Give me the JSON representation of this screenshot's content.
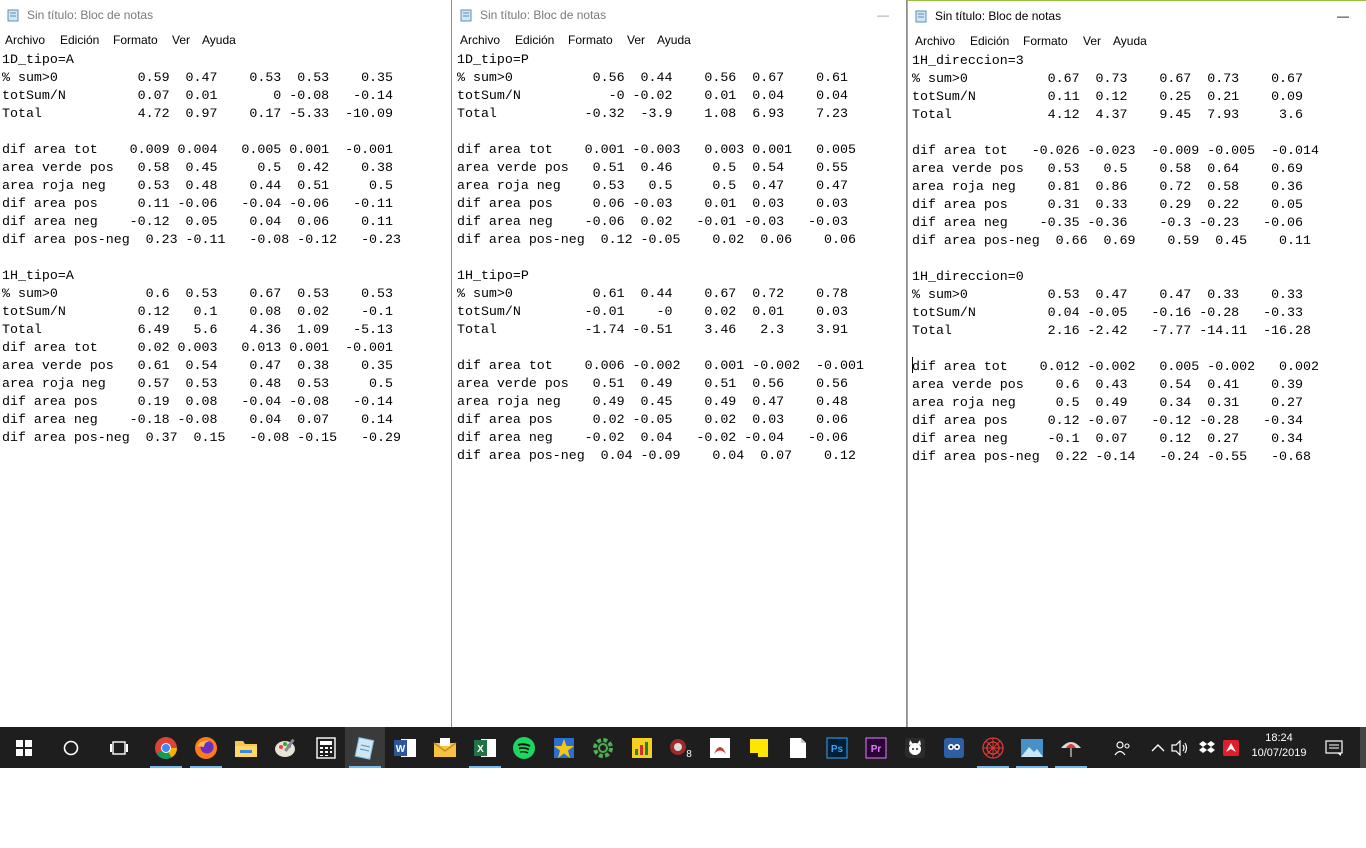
{
  "windows": [
    {
      "title": "Sin título: Bloc de notas",
      "menu": [
        "Archivo",
        "Edición",
        "Formato",
        "Ver",
        "Ayuda"
      ],
      "content": "1D_tipo=A\n% sum>0          0.59  0.47    0.53  0.53    0.35\ntotSum/N         0.07  0.01       0 -0.08   -0.14\nTotal            4.72  0.97    0.17 -5.33  -10.09\n\ndif area tot    0.009 0.004   0.005 0.001  -0.001\narea verde pos   0.58  0.45     0.5  0.42    0.38\narea roja neg    0.53  0.48    0.44  0.51     0.5\ndif area pos     0.11 -0.06   -0.04 -0.06   -0.11\ndif area neg    -0.12  0.05    0.04  0.06    0.11\ndif area pos-neg  0.23 -0.11   -0.08 -0.12   -0.23\n\n1H_tipo=A\n% sum>0           0.6  0.53    0.67  0.53    0.53\ntotSum/N         0.12   0.1    0.08  0.02    -0.1\nTotal            6.49   5.6    4.36  1.09   -5.13\ndif area tot     0.02 0.003   0.013 0.001  -0.001\narea verde pos   0.61  0.54    0.47  0.38    0.35\narea roja neg    0.57  0.53    0.48  0.53     0.5\ndif area pos     0.19  0.08   -0.04 -0.08   -0.14\ndif area neg    -0.18 -0.08    0.04  0.07    0.14\ndif area pos-neg  0.37  0.15   -0.08 -0.15   -0.29"
    },
    {
      "title": "Sin título: Bloc de notas",
      "minimize": "—",
      "menu": [
        "Archivo",
        "Edición",
        "Formato",
        "Ver",
        "Ayuda"
      ],
      "content": "1D_tipo=P\n% sum>0          0.56  0.44    0.56  0.67    0.61\ntotSum/N           -0 -0.02    0.01  0.04    0.04\nTotal           -0.32  -3.9    1.08  6.93    7.23\n\ndif area tot    0.001 -0.003   0.003 0.001   0.005\narea verde pos   0.51  0.46     0.5  0.54    0.55\narea roja neg    0.53   0.5     0.5  0.47    0.47\ndif area pos     0.06 -0.03    0.01  0.03    0.03\ndif area neg    -0.06  0.02   -0.01 -0.03   -0.03\ndif area pos-neg  0.12 -0.05    0.02  0.06    0.06\n\n1H_tipo=P\n% sum>0          0.61  0.44    0.67  0.72    0.78\ntotSum/N        -0.01    -0    0.02  0.01    0.03\nTotal           -1.74 -0.51    3.46   2.3    3.91\n\ndif area tot    0.006 -0.002   0.001 -0.002  -0.001\narea verde pos   0.51  0.49    0.51  0.56    0.56\narea roja neg    0.49  0.45    0.49  0.47    0.48\ndif area pos     0.02 -0.05    0.02  0.03    0.06\ndif area neg    -0.02  0.04   -0.02 -0.04   -0.06\ndif area pos-neg  0.04 -0.09    0.04  0.07    0.12"
    },
    {
      "title": "Sin título: Bloc de notas",
      "minimize": "—",
      "menu": [
        "Archivo",
        "Edición",
        "Formato",
        "Ver",
        "Ayuda"
      ],
      "content": "1H_direccion=3\n% sum>0          0.67  0.73    0.67  0.73    0.67\ntotSum/N         0.11  0.12    0.25  0.21    0.09\nTotal            4.12  4.37    9.45  7.93     3.6\n\ndif area tot   -0.026 -0.023  -0.009 -0.005  -0.014\narea verde pos   0.53   0.5    0.58  0.64    0.69\narea roja neg    0.81  0.86    0.72  0.58    0.36\ndif area pos     0.31  0.33    0.29  0.22    0.05\ndif area neg    -0.35 -0.36    -0.3 -0.23   -0.06\ndif area pos-neg  0.66  0.69    0.59  0.45    0.11\n\n1H_direccion=0\n% sum>0          0.53  0.47    0.47  0.33    0.33\ntotSum/N         0.04 -0.05   -0.16 -0.28   -0.33\nTotal            2.16 -2.42   -7.77 -14.11  -16.28\n\ndif area tot    0.012 -0.002   0.005 -0.002   0.002\narea verde pos    0.6  0.43    0.54  0.41    0.39\narea roja neg     0.5  0.49    0.34  0.31    0.27\ndif area pos     0.12 -0.07   -0.12 -0.28   -0.34\ndif area neg     -0.1  0.07    0.12  0.27    0.34\ndif area pos-neg  0.22 -0.14   -0.24 -0.55   -0.68"
    }
  ],
  "taskbar": {
    "clock": {
      "time": "18:24",
      "date": "10/07/2019"
    },
    "apps": [
      "start-icon",
      "cortana-icon",
      "task-view-icon",
      "chrome-icon",
      "firefox-icon",
      "file-explorer-icon",
      "paint-icon",
      "calculator-icon",
      "notepad-icon",
      "word-icon",
      "mail-icon",
      "excel-icon",
      "spotify-icon",
      "star-app-icon",
      "settings-gear-icon",
      "chart-app-icon",
      "badge-app-icon",
      "acrobat-icon",
      "sticky-notes-icon",
      "document-icon",
      "photoshop-icon",
      "premiere-icon",
      "github-icon",
      "owl-app-icon",
      "spider-web-icon",
      "photos-icon",
      "umbrella-app-icon"
    ],
    "tray_icons": [
      "people-icon",
      "chevron-up-icon",
      "volume-icon",
      "dropbox-icon",
      "antivirus-icon",
      "notifications-icon"
    ],
    "accent_color": "#76b9ed",
    "background": "#1e1e1e"
  }
}
